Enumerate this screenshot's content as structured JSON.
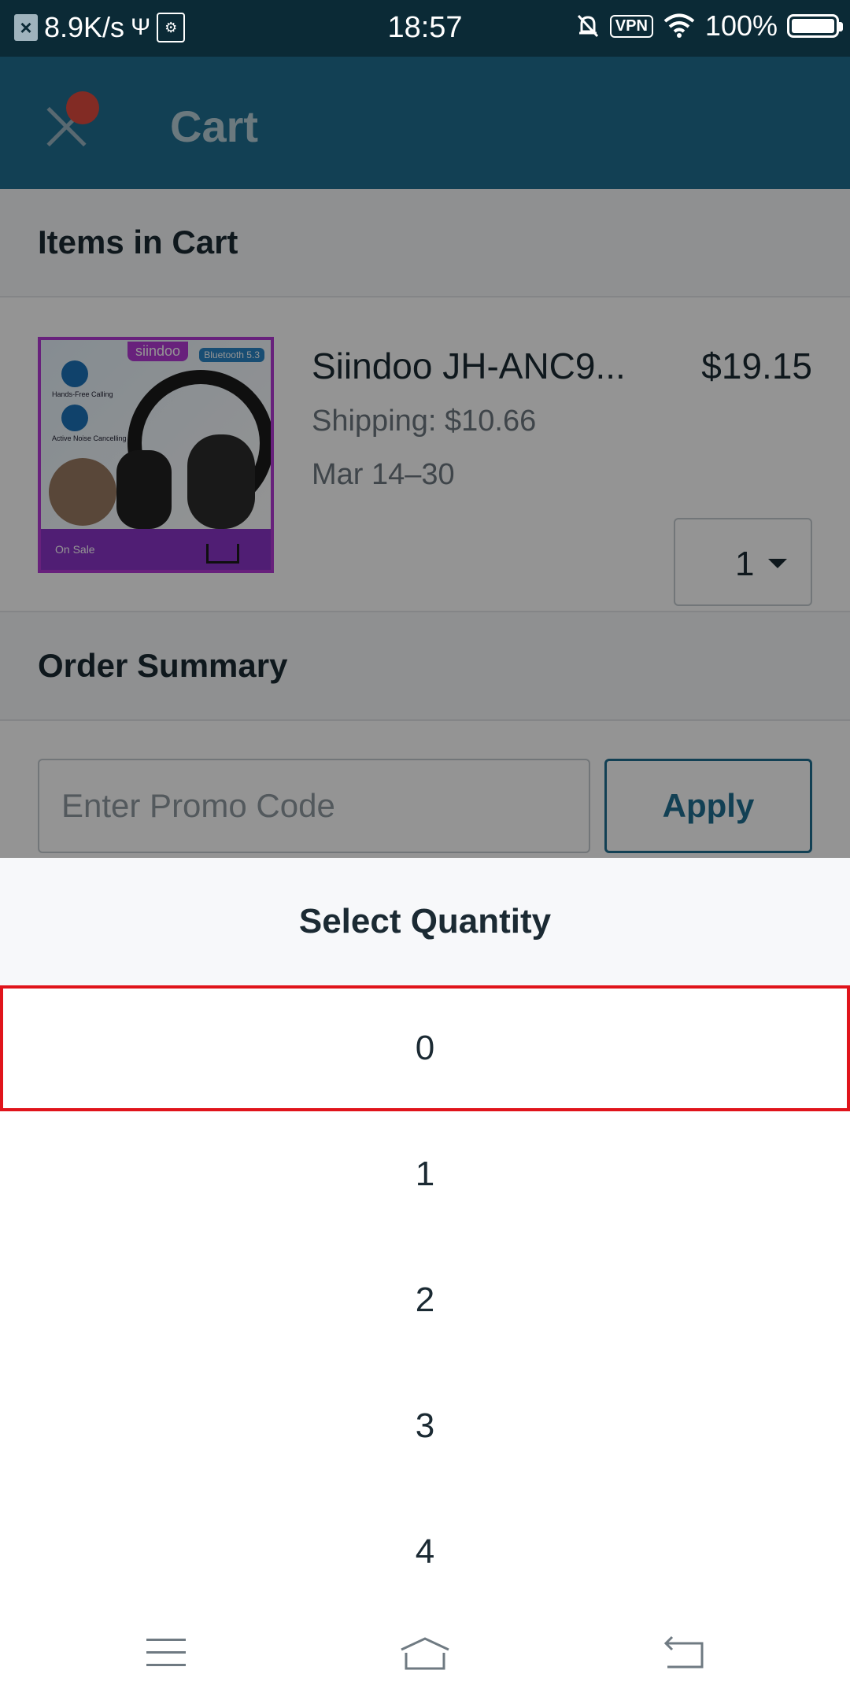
{
  "status_bar": {
    "speed": "8.9K/s",
    "time": "18:57",
    "vpn": "VPN",
    "battery": "100%"
  },
  "header": {
    "title": "Cart"
  },
  "cart": {
    "section_title": "Items in Cart",
    "item": {
      "brand": "siindoo",
      "image_badge": "Bluetooth 5.3",
      "image_feature_1": "Hands-Free Calling",
      "image_feature_2": "Active Noise Cancelling",
      "image_banner": "On Sale",
      "name": "Siindoo JH-ANC9...",
      "price": "$19.15",
      "shipping": "Shipping: $10.66",
      "delivery": "Mar 14–30",
      "quantity": "1"
    }
  },
  "order_summary": {
    "title": "Order Summary",
    "promo_placeholder": "Enter Promo Code",
    "apply_label": "Apply"
  },
  "sheet": {
    "title": "Select Quantity",
    "options": [
      "0",
      "1",
      "2",
      "3",
      "4"
    ],
    "highlighted_index": 0
  },
  "nav_icons": [
    "menu-icon",
    "home-icon",
    "back-icon"
  ],
  "colors": {
    "header_bg": "#1f6f91",
    "highlight_border": "#e0141b",
    "status_bar_bg": "#0b2a36"
  }
}
